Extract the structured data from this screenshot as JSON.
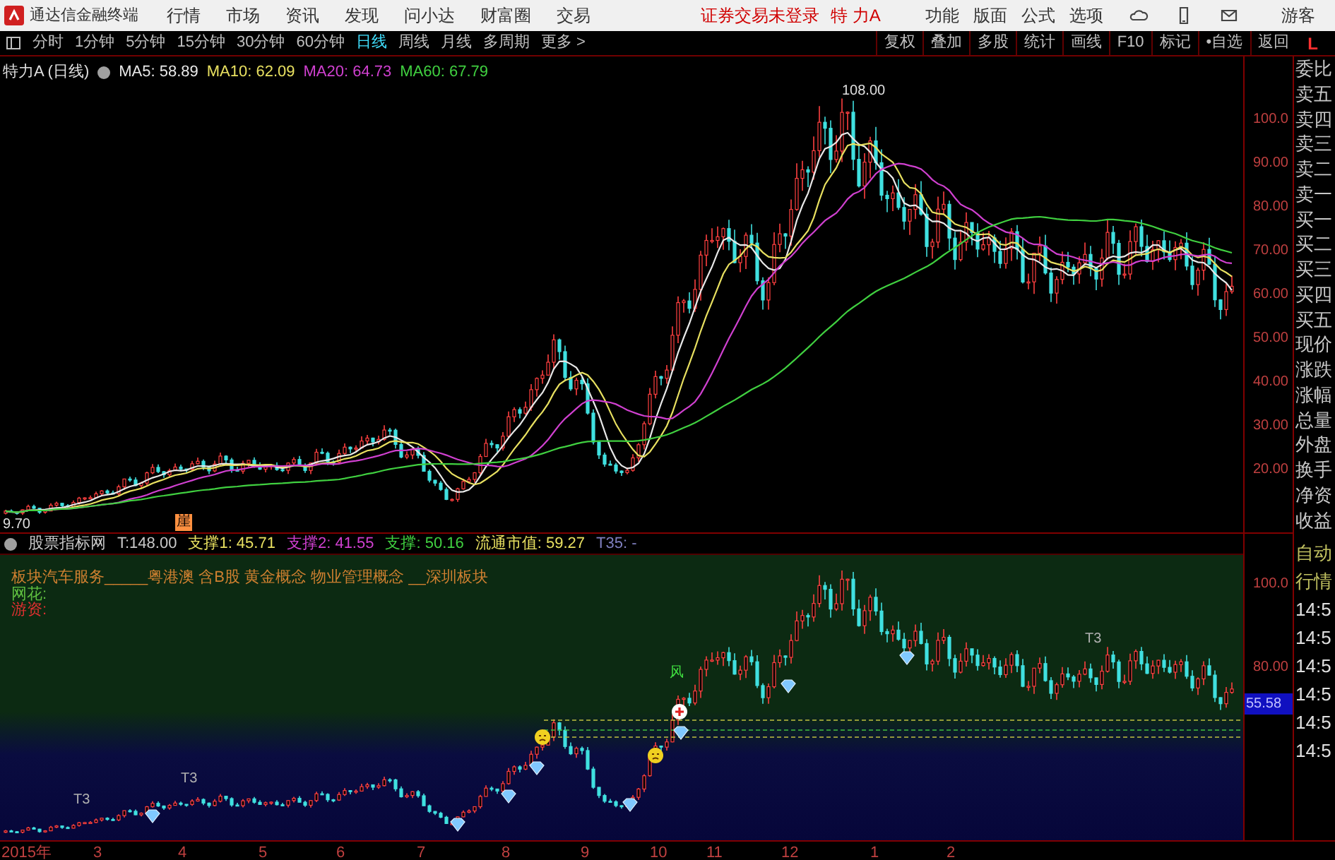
{
  "title_bar": {
    "app_name": "通达信金融终端",
    "menus": [
      "行情",
      "市场",
      "资讯",
      "发现",
      "问小达",
      "财富圈",
      "交易"
    ],
    "notice": "证券交易未登录",
    "stock": "特 力A",
    "tools": [
      "功能",
      "版面",
      "公式",
      "选项"
    ],
    "user": "游客"
  },
  "toolbar": {
    "periods": [
      {
        "label": "分时",
        "selected": false
      },
      {
        "label": "1分钟",
        "selected": false
      },
      {
        "label": "5分钟",
        "selected": false
      },
      {
        "label": "15分钟",
        "selected": false
      },
      {
        "label": "30分钟",
        "selected": false
      },
      {
        "label": "60分钟",
        "selected": false
      },
      {
        "label": "日线",
        "selected": true
      },
      {
        "label": "周线",
        "selected": false
      },
      {
        "label": "月线",
        "selected": false
      },
      {
        "label": "多周期",
        "selected": false
      },
      {
        "label": "更多 >",
        "selected": false
      }
    ],
    "actions": [
      "复权",
      "叠加",
      "多股",
      "统计",
      "画线",
      "F10",
      "标记",
      "•自选",
      "返回"
    ],
    "corner": "L"
  },
  "main_chart": {
    "title": "特力A (日线)",
    "ma": [
      {
        "label": "MA5: 58.89",
        "color": "#e8e8e8"
      },
      {
        "label": "MA10: 62.09",
        "color": "#e8e060"
      },
      {
        "label": "MA20: 64.73",
        "color": "#d040d0"
      },
      {
        "label": "MA60: 67.79",
        "color": "#40d040"
      }
    ],
    "high_label": "108.00",
    "low_label": "9.70",
    "marker": "崖",
    "y_axis": [
      "100.0",
      "90.00",
      "80.00",
      "70.00",
      "60.00",
      "50.00",
      "40.00",
      "30.00",
      "20.00"
    ]
  },
  "quote_panel": [
    "委比",
    "卖五",
    "卖四",
    "卖三",
    "卖二",
    "卖一",
    "买一",
    "买二",
    "买三",
    "买四",
    "买五",
    "现价",
    "涨跌",
    "涨幅",
    "总量",
    "外盘",
    "换手",
    "净资",
    "收益"
  ],
  "indicator": {
    "header": [
      {
        "text": "股票指标网",
        "color": "#c8c8c8"
      },
      {
        "text": "T:148.00",
        "color": "#c8c8c8"
      },
      {
        "text": "支撑1: 45.71",
        "color": "#e8e060"
      },
      {
        "text": "支撑2: 41.55",
        "color": "#d040d0"
      },
      {
        "text": "支撑: 50.16",
        "color": "#40d040"
      },
      {
        "text": "流通市值: 59.27",
        "color": "#e8e060"
      },
      {
        "text": "T35: -",
        "color": "#8080c0"
      }
    ],
    "concepts": "板块汽车服务_____粤港澳 含B股 黄金概念 物业管理概念 __深圳板块",
    "line2": "网花:",
    "line3": "游资:",
    "tags": [
      {
        "text": "T3",
        "kind": "plain"
      },
      {
        "text": "T3",
        "kind": "plain"
      },
      {
        "text": "T3",
        "kind": "plain"
      },
      {
        "text": "风",
        "kind": "green"
      }
    ],
    "y_axis": [
      "100.0",
      "80.00"
    ],
    "current": "55.58"
  },
  "side_panel": {
    "buttons": [
      "自动",
      "行情"
    ],
    "times": [
      "14:5",
      "14:5",
      "14:5",
      "14:5",
      "14:5",
      "14:5"
    ]
  },
  "x_axis": [
    "2015年",
    "3",
    "4",
    "5",
    "6",
    "7",
    "8",
    "9",
    "10",
    "11",
    "12",
    "1",
    "2"
  ]
}
